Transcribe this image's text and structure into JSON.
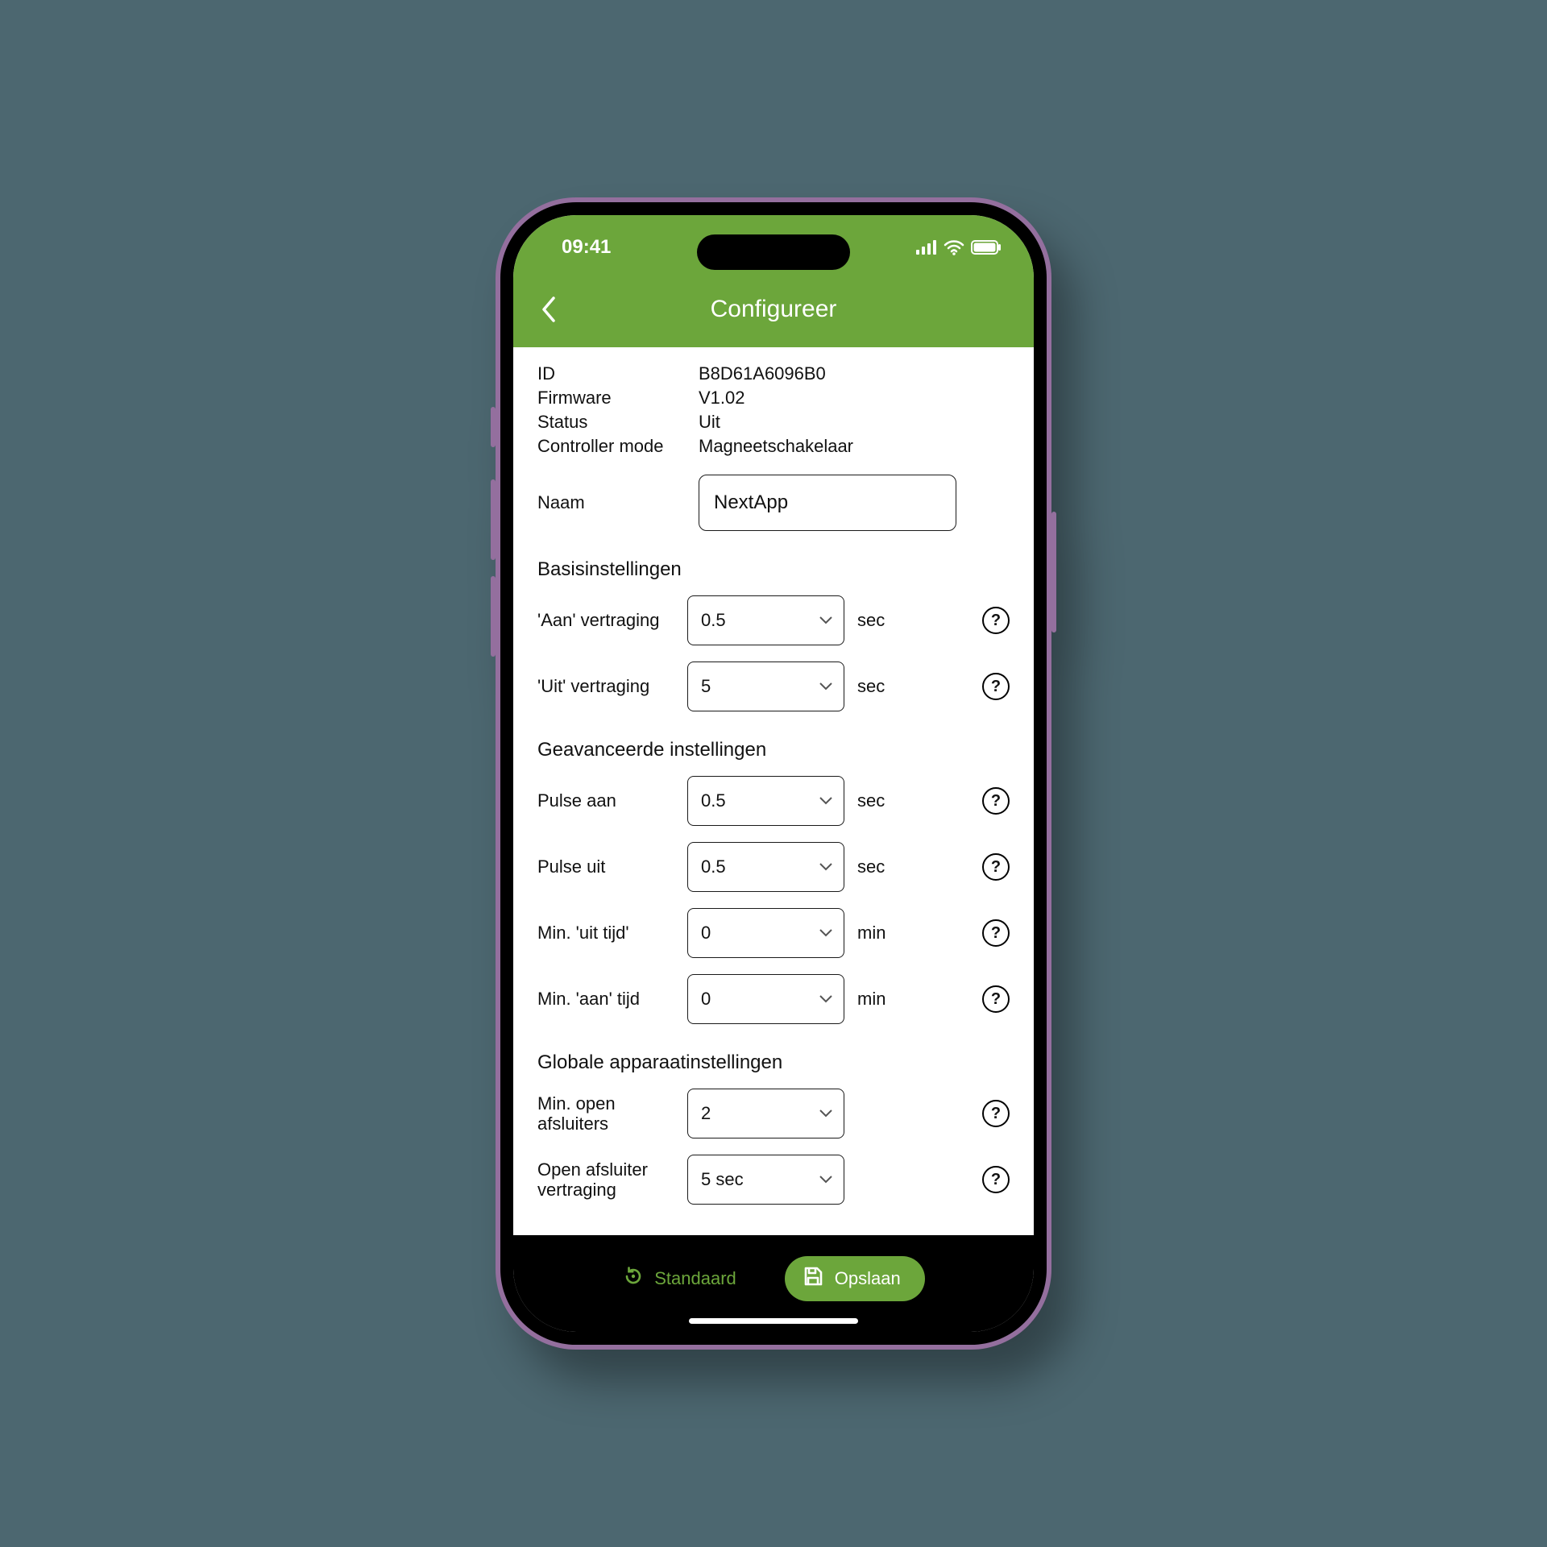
{
  "status_bar": {
    "time": "09:41"
  },
  "header": {
    "title": "Configureer"
  },
  "info": {
    "id_label": "ID",
    "id_value": "B8D61A6096B0",
    "fw_label": "Firmware",
    "fw_value": "V1.02",
    "status_label": "Status",
    "status_value": "Uit",
    "mode_label": "Controller mode",
    "mode_value": "Magneetschakelaar"
  },
  "name_field": {
    "label": "Naam",
    "value": "NextApp"
  },
  "sections": {
    "basic": {
      "title": "Basisinstellingen",
      "on_delay": {
        "label": "'Aan' vertraging",
        "value": "0.5",
        "unit": "sec"
      },
      "off_delay": {
        "label": "'Uit' vertraging",
        "value": "5",
        "unit": "sec"
      }
    },
    "advanced": {
      "title": "Geavanceerde instellingen",
      "pulse_on": {
        "label": "Pulse aan",
        "value": "0.5",
        "unit": "sec"
      },
      "pulse_off": {
        "label": "Pulse uit",
        "value": "0.5",
        "unit": "sec"
      },
      "min_off": {
        "label": "Min. 'uit tijd'",
        "value": "0",
        "unit": "min"
      },
      "min_on": {
        "label": "Min. 'aan' tijd",
        "value": "0",
        "unit": "min"
      }
    },
    "global": {
      "title": "Globale apparaatinstellingen",
      "min_open": {
        "label": "Min. open afsluiters",
        "value": "2",
        "unit": ""
      },
      "open_delay": {
        "label": "Open afsluiter vertraging",
        "value": "5 sec",
        "unit": ""
      }
    }
  },
  "footer": {
    "default_label": "Standaard",
    "save_label": "Opslaan"
  }
}
